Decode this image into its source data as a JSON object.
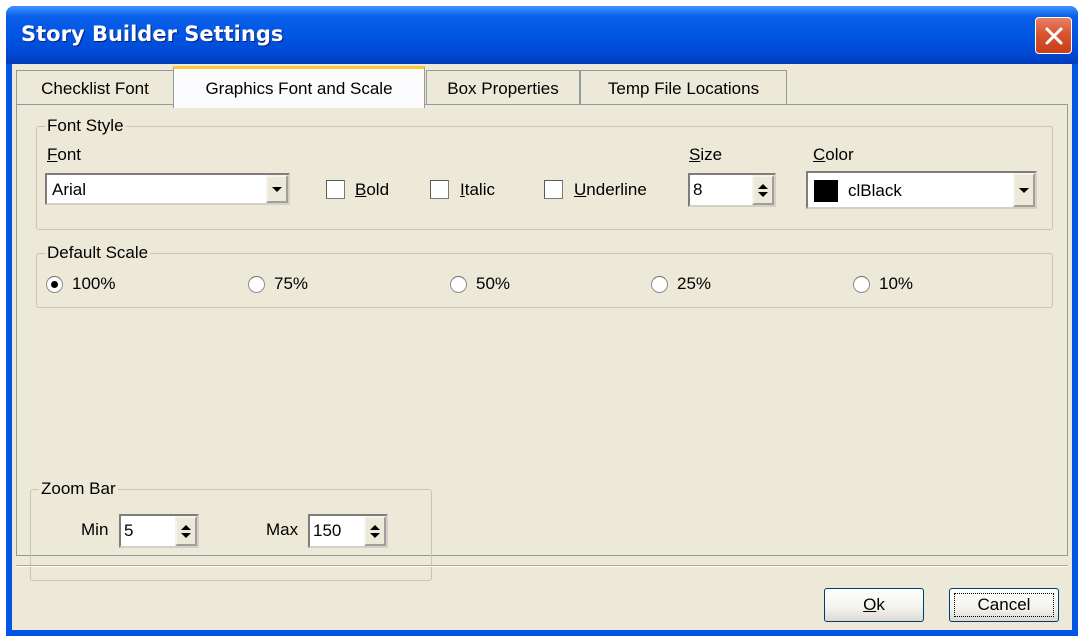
{
  "window": {
    "title": "Story Builder Settings",
    "close_icon": "close-icon"
  },
  "tabs": [
    {
      "label": "Checklist Font",
      "active": false
    },
    {
      "label": "Graphics Font and Scale",
      "active": true
    },
    {
      "label": "Box Properties",
      "active": false
    },
    {
      "label": "Temp File Locations",
      "active": false
    }
  ],
  "font_style": {
    "group_label": "Font Style",
    "font": {
      "label": "Font",
      "value": "Arial"
    },
    "bold": {
      "label": "Bold",
      "checked": false
    },
    "italic": {
      "label": "Italic",
      "checked": false
    },
    "underline": {
      "label": "Underline",
      "checked": false
    },
    "size": {
      "label": "Size",
      "value": "8"
    },
    "color": {
      "label": "Color",
      "value": "clBlack",
      "swatch": "#000000"
    }
  },
  "default_scale": {
    "group_label": "Default Scale",
    "options": [
      {
        "label": "100%",
        "selected": true
      },
      {
        "label": "75%",
        "selected": false
      },
      {
        "label": "50%",
        "selected": false
      },
      {
        "label": "25%",
        "selected": false
      },
      {
        "label": "10%",
        "selected": false
      }
    ]
  },
  "zoom_bar": {
    "group_label": "Zoom Bar",
    "min": {
      "label": "Min",
      "value": "5"
    },
    "max": {
      "label": "Max",
      "value": "150"
    }
  },
  "buttons": {
    "ok": {
      "label": "Ok",
      "accel": "O",
      "rest": "k"
    },
    "cancel": {
      "label": "Cancel"
    }
  },
  "colors": {
    "titlebar": "#0054e3",
    "dialog_bg": "#ece9d8",
    "active_tab_accent": "#ffc83c",
    "close_button": "#d9542f"
  }
}
